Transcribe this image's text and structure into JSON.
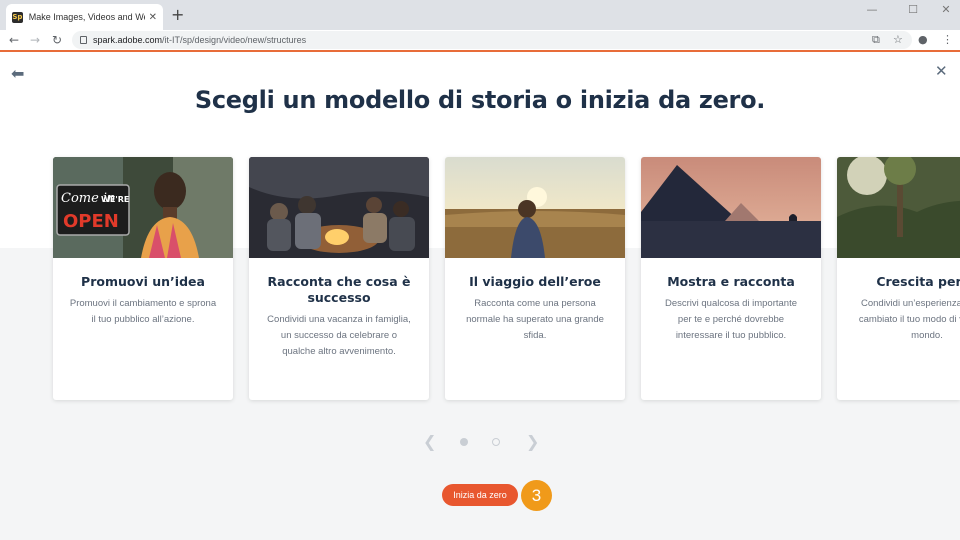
{
  "browser": {
    "tab_title": "Make Images, Videos and Web S",
    "tab_favicon": "Sp",
    "new_tab": "+",
    "url_host": "spark.adobe.com",
    "url_path": "/it-IT/sp/design/video/new/structures",
    "icons": [
      "back-arrow-icon",
      "forward-arrow-icon",
      "reload-icon",
      "lock-icon",
      "translate-icon",
      "star-icon",
      "profile-icon",
      "menu-icon"
    ]
  },
  "page": {
    "headline": "Scegli un modello di storia o inizia da zero.",
    "cards": [
      {
        "title": "Promuovi un’idea",
        "desc": "Promuovi il cambiamento e sprona il tuo pubblico all’azione."
      },
      {
        "title": "Racconta che cosa è successo",
        "desc": "Condividi una vacanza in famiglia, un successo da celebrare o qualche altro avvenimento."
      },
      {
        "title": "Il viaggio dell’eroe",
        "desc": "Racconta come una persona normale ha superato una grande sfida."
      },
      {
        "title": "Mostra e racconta",
        "desc": "Descrivi qualcosa di importante per te e perché dovrebbe interessare il tuo pubblico."
      },
      {
        "title": "Crescita perso",
        "desc": "Condividi un’esperienza che ha cambiato il tuo modo di vedere il mondo."
      }
    ],
    "sign_text": {
      "line1": "Come in",
      "line2": "WE'RE",
      "line3": "OPEN"
    },
    "cta_label": "Inizia da zero",
    "step_number": "3",
    "pager": {
      "active_index": 0,
      "total": 2
    },
    "colors": {
      "accent": "#e8572f",
      "badge": "#f09a1a",
      "heading": "#1f3148"
    }
  }
}
